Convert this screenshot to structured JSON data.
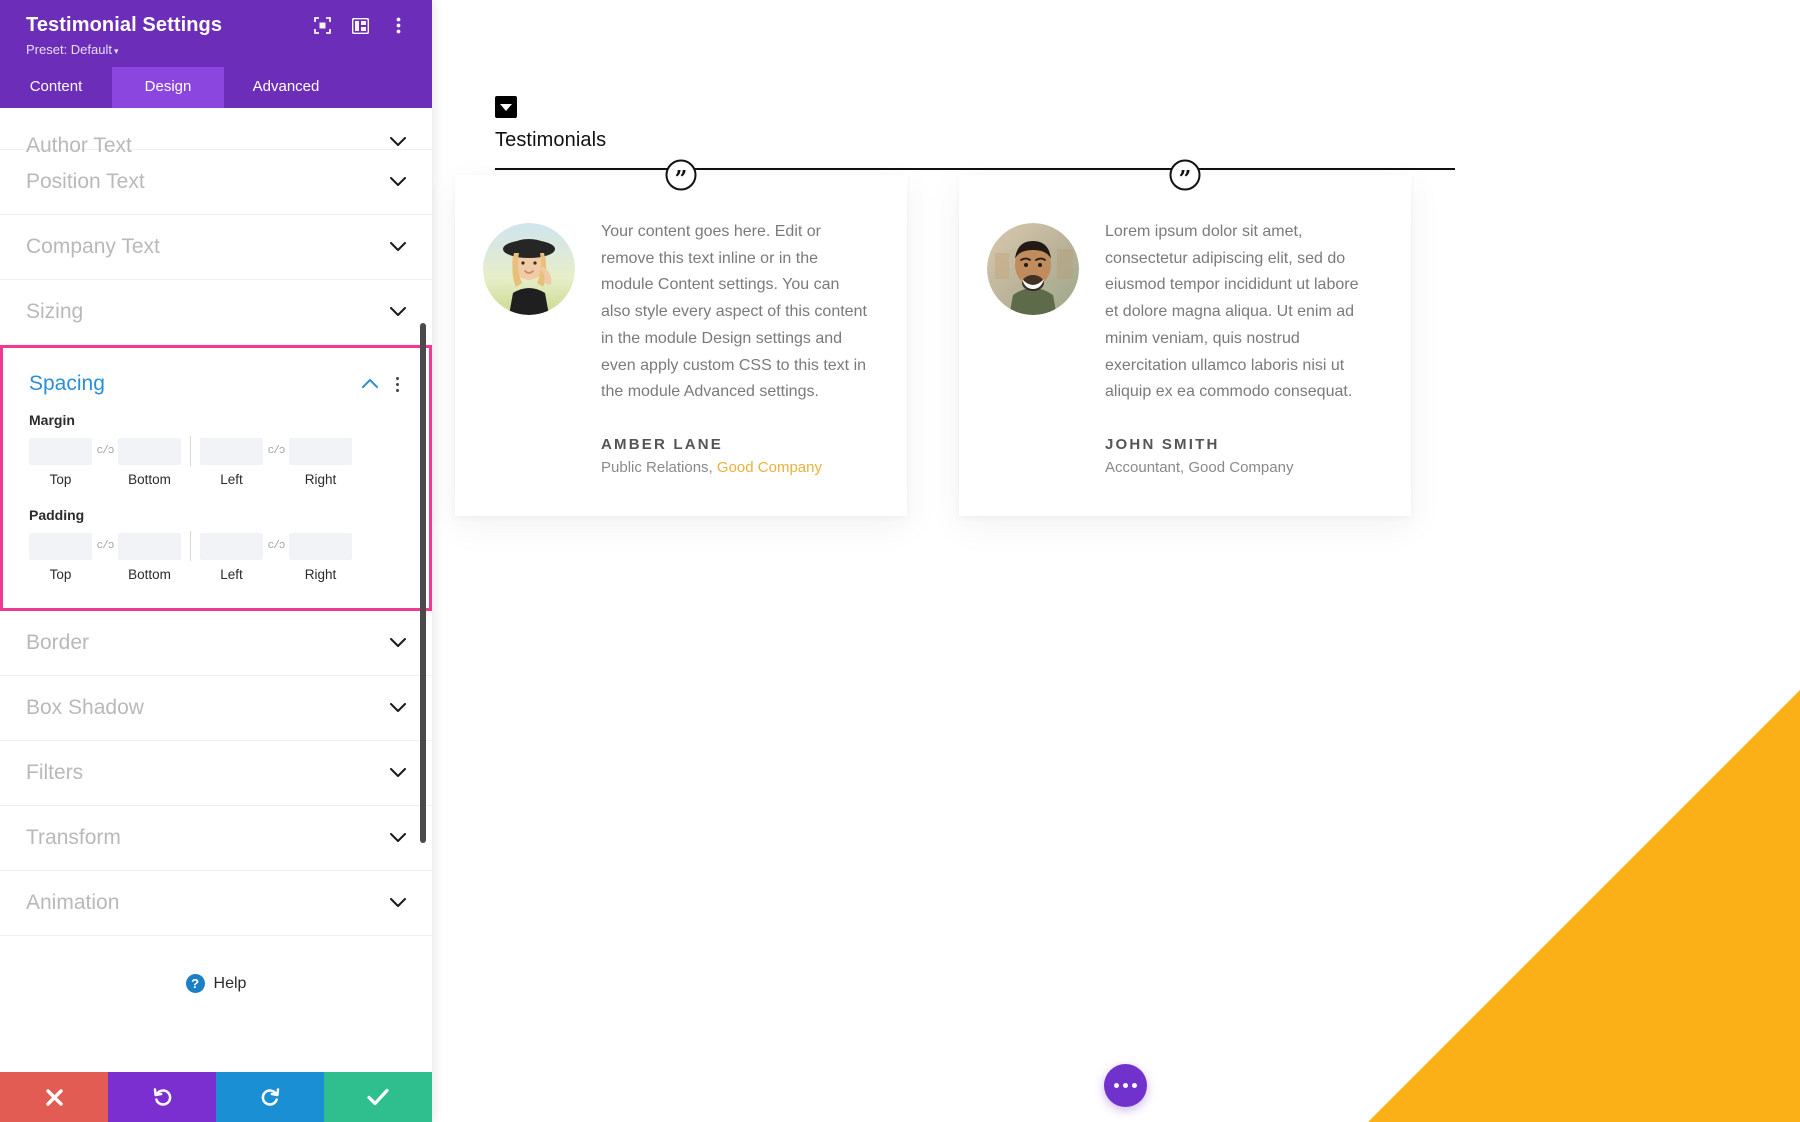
{
  "panel": {
    "title": "Testimonial Settings",
    "preset_label": "Preset: Default",
    "preset_caret": "▾",
    "header_icons": [
      {
        "name": "focus-icon"
      },
      {
        "name": "layout-icon"
      },
      {
        "name": "more-vertical-icon"
      }
    ],
    "tabs": [
      {
        "label": "Content",
        "active": false
      },
      {
        "label": "Design",
        "active": true
      },
      {
        "label": "Advanced",
        "active": false
      }
    ],
    "sections_above": [
      {
        "label": "Author Text",
        "state": "collapsed"
      },
      {
        "label": "Position Text",
        "state": "collapsed"
      },
      {
        "label": "Company Text",
        "state": "collapsed"
      },
      {
        "label": "Sizing",
        "state": "collapsed"
      }
    ],
    "spacing": {
      "title": "Spacing",
      "state": "expanded",
      "highlighted": true,
      "highlight_color": "#ef3a92",
      "title_color": "#2a8fd8",
      "groups": [
        {
          "label": "Margin",
          "fields": [
            {
              "caption": "Top",
              "value": "",
              "placeholder": ""
            },
            {
              "caption": "Bottom",
              "value": "",
              "placeholder": ""
            },
            {
              "caption": "Left",
              "value": "",
              "placeholder": ""
            },
            {
              "caption": "Right",
              "value": "",
              "placeholder": ""
            }
          ],
          "link_icon": "c/ɔ"
        },
        {
          "label": "Padding",
          "fields": [
            {
              "caption": "Top",
              "value": "",
              "placeholder": ""
            },
            {
              "caption": "Bottom",
              "value": "",
              "placeholder": ""
            },
            {
              "caption": "Left",
              "value": "",
              "placeholder": ""
            },
            {
              "caption": "Right",
              "value": "",
              "placeholder": ""
            }
          ],
          "link_icon": "c/ɔ"
        }
      ]
    },
    "sections_below": [
      {
        "label": "Border",
        "state": "collapsed"
      },
      {
        "label": "Box Shadow",
        "state": "collapsed"
      },
      {
        "label": "Filters",
        "state": "collapsed"
      },
      {
        "label": "Transform",
        "state": "collapsed"
      },
      {
        "label": "Animation",
        "state": "collapsed"
      }
    ],
    "help": {
      "label": "Help",
      "glyph": "?"
    },
    "actions": [
      {
        "name": "cancel",
        "icon": "close-icon",
        "color": "#e25c54"
      },
      {
        "name": "undo",
        "icon": "undo-icon",
        "color": "#7c2fd1"
      },
      {
        "name": "redo",
        "icon": "redo-icon",
        "color": "#1b8fd4"
      },
      {
        "name": "save",
        "icon": "check-icon",
        "color": "#2fbf8f"
      }
    ]
  },
  "canvas": {
    "section_title": "Testimonials",
    "accent_triangle_color": "#fbb018",
    "fab": {
      "icon": "ellipsis-icon",
      "color": "#7031cc"
    },
    "testimonials": [
      {
        "quote": "Your content goes here. Edit or remove this text inline or in the module Content settings. You can also style every aspect of this content in the module Design settings and even apply custom CSS to this text in the module Advanced settings.",
        "author": "AMBER LANE",
        "position": "Public Relations, ",
        "company": "Good Company",
        "company_is_link": true,
        "company_color": "#e8b23a",
        "avatar_alt": "woman-with-hat-avatar"
      },
      {
        "quote": "Lorem ipsum dolor sit amet, consectetur adipiscing elit, sed do eiusmod tempor incididunt ut labore et dolore magna aliqua. Ut enim ad minim veniam, quis nostrud exercitation ullamco laboris nisi ut aliquip ex ea commodo consequat.",
        "author": "JOHN SMITH",
        "position": "Accountant, Good Company",
        "company": "",
        "company_is_link": false,
        "company_color": "#8a8a8a",
        "avatar_alt": "smiling-man-avatar"
      }
    ]
  }
}
